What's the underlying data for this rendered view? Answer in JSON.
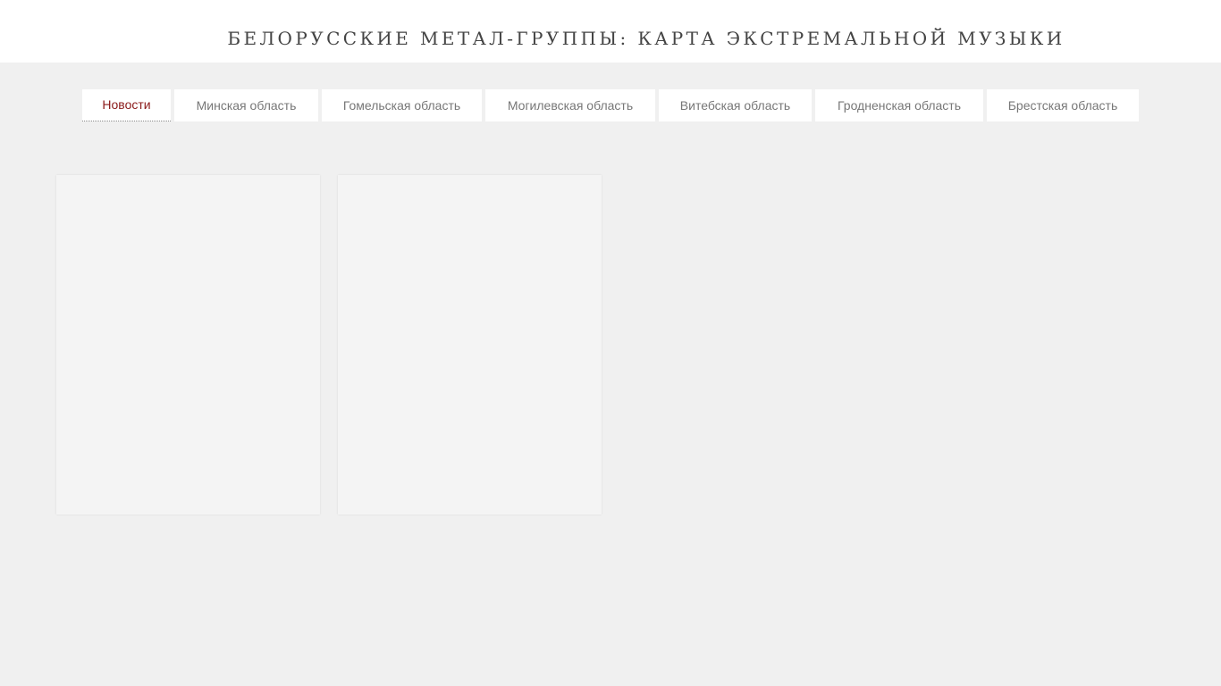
{
  "header": {
    "title": "БЕЛОРУССКИЕ МЕТАЛ-ГРУППЫ: КАРТА ЭКСТРЕМАЛЬНОЙ МУЗЫКИ"
  },
  "nav": {
    "active_tab": "Новости",
    "accent_color": "#8b1a1a",
    "tabs": [
      {
        "label": "Новости"
      },
      {
        "label": "Минская область"
      },
      {
        "label": "Гомельская область"
      },
      {
        "label": "Могилевская область"
      },
      {
        "label": "Витебская область"
      },
      {
        "label": "Гродненская область"
      },
      {
        "label": "Брестская область"
      }
    ]
  }
}
